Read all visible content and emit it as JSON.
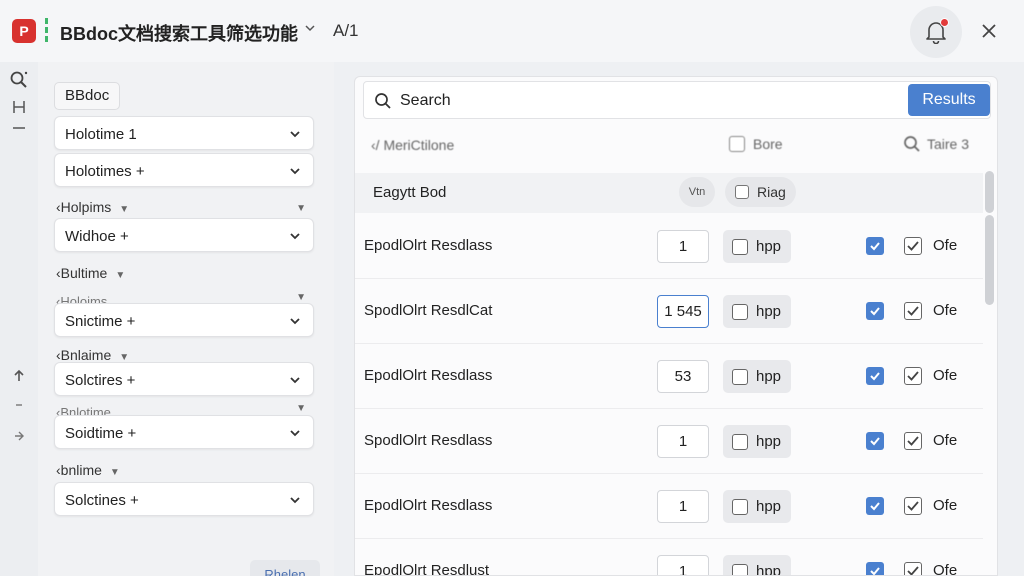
{
  "titlebar": {
    "logo_glyph": "P",
    "title": "BBdoc文档搜索工具筛选功能",
    "version": "A/1"
  },
  "sidebar": {
    "tag": "BBdoc",
    "selects": [
      {
        "label": "Holotime 1"
      },
      {
        "label": "Holotimes +"
      },
      {
        "label": "Widhoe +"
      },
      {
        "label": "Snictime +"
      },
      {
        "label": "Solctires +"
      },
      {
        "label": "Soidtime +"
      },
      {
        "label": "Solctines +"
      }
    ],
    "groups": [
      {
        "label": "‹Holpims"
      },
      {
        "label": "‹Bultime"
      },
      {
        "label": "‹Bnlaime"
      },
      {
        "label": "‹bnlime"
      }
    ],
    "ghosts": [
      {
        "label": "‹Holoims"
      },
      {
        "label": "‹Bnlotime"
      },
      {
        "label": "‹Bnlotime"
      }
    ],
    "bottom_button": "Rhelen"
  },
  "search": {
    "placeholder": "Search",
    "results_label": "Results"
  },
  "toolbar": {
    "back_label": "‹/ MeriCtilone",
    "check_label": "Bore",
    "tools_label": "Taire 3"
  },
  "table": {
    "header": {
      "name": "Eagytt Bod",
      "pill": "Vtn",
      "flag": "Riag"
    },
    "rows": [
      {
        "name": "EpodlOlrt Resdlass",
        "qty": "1",
        "opt": "hpp",
        "label": "Ofe",
        "focused": false
      },
      {
        "name": "SpodlOlrt ResdlCat",
        "qty": "1 545",
        "opt": "hpp",
        "label": "Ofe",
        "focused": true
      },
      {
        "name": "EpodlOlrt Resdlass",
        "qty": "53",
        "opt": "hpp",
        "label": "Ofe",
        "focused": false
      },
      {
        "name": "SpodlOlrt Resdlass",
        "qty": "1",
        "opt": "hpp",
        "label": "Ofe",
        "focused": false
      },
      {
        "name": "EpodlOlrt Resdlass",
        "qty": "1",
        "opt": "hpp",
        "label": "Ofe",
        "focused": false
      },
      {
        "name": "EpodlOlrt Resdlust",
        "qty": "1",
        "opt": "hpp",
        "label": "Ofe",
        "focused": false
      }
    ]
  },
  "colors": {
    "accent": "#4a80cf",
    "logo_red": "#d8322f",
    "logo_green": "#3fb66a",
    "alert_dot": "#e23b3b"
  }
}
